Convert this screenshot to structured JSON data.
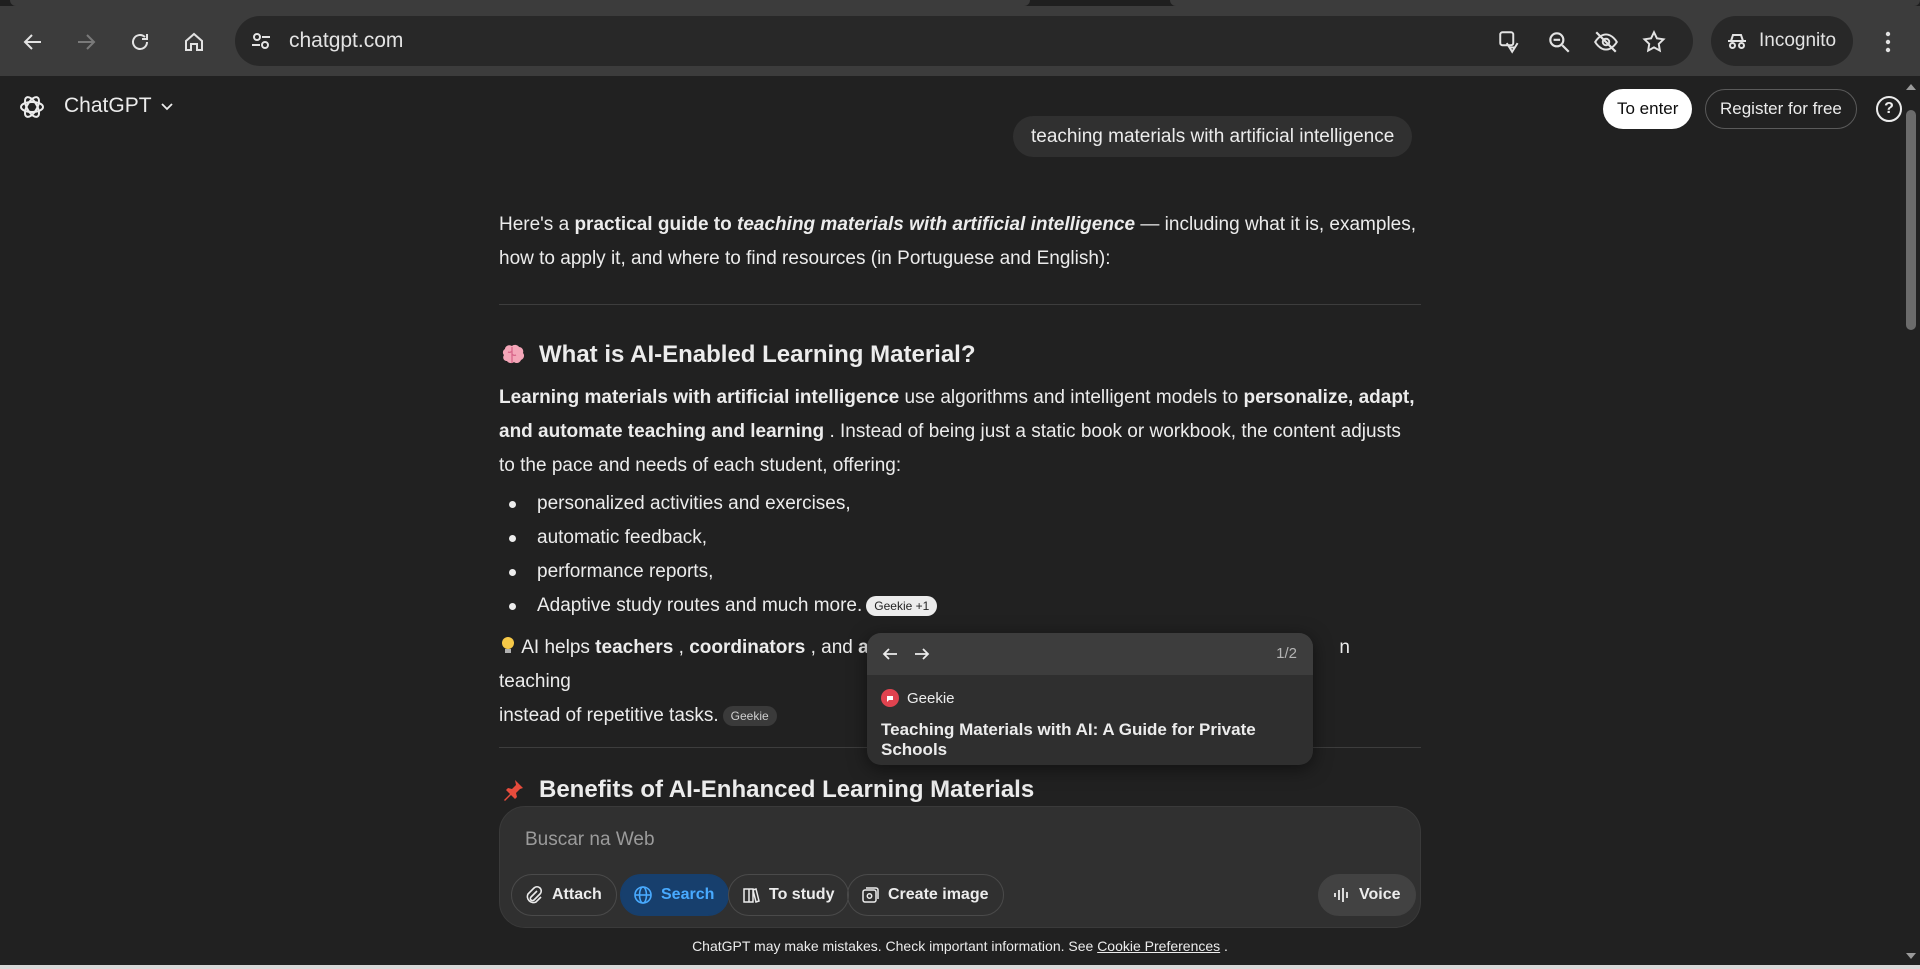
{
  "browser": {
    "url": "chatgpt.com",
    "incognito_label": "Incognito"
  },
  "app": {
    "brand": "ChatGPT",
    "enter_label": "To enter",
    "register_label": "Register for free",
    "help_label": "?"
  },
  "user_message": "teaching materials with artificial intelligence",
  "answer": {
    "intro_prefix": "Here's a ",
    "intro_bold": "practical guide to ",
    "intro_bold_italic": "teaching materials with artificial intelligence",
    "intro_suffix": " — including what it is, examples, how to apply it, and where to find resources (in Portuguese and English):",
    "section1_title": "What is AI-Enabled Learning Material?",
    "p1_bold1": "Learning materials with artificial intelligence",
    "p1_text1": " use algorithms and intelligent models to ",
    "p1_bold2": "personalize, adapt, and automate teaching and learning",
    "p1_text2": " . Instead of being just a static book or workbook, the content adjusts to the pace and needs of each student, offering:",
    "bullets": [
      "personalized activities and exercises,",
      "automatic feedback,",
      "performance reports,",
      "Adaptive study routes and much more."
    ],
    "bullet_chip": "Geekie +1",
    "tip_text1": " AI helps ",
    "tip_bold1": "teachers",
    "tip_text2": " , ",
    "tip_bold2": "coordinators",
    "tip_text3": " , and ",
    "tip_bold3": "ad",
    "tip_tail": "n teaching",
    "tip_line2": "instead of repetitive tasks.",
    "tip_chip": "Geekie",
    "section2_title": "Benefits of AI-Enhanced Learning Materials"
  },
  "popover": {
    "count": "1/2",
    "source": "Geekie",
    "title": "Teaching Materials with AI: A Guide for Private Schools"
  },
  "composer": {
    "placeholder": "Buscar na Web",
    "attach": "Attach",
    "search": "Search",
    "study": "To study",
    "create_image": "Create image",
    "voice": "Voice"
  },
  "footer": {
    "text": "ChatGPT may make mistakes. Check important information. See ",
    "link": "Cookie Preferences",
    "end": " ."
  },
  "colors": {
    "background": "#212121",
    "accent_search": "#48aaff"
  }
}
